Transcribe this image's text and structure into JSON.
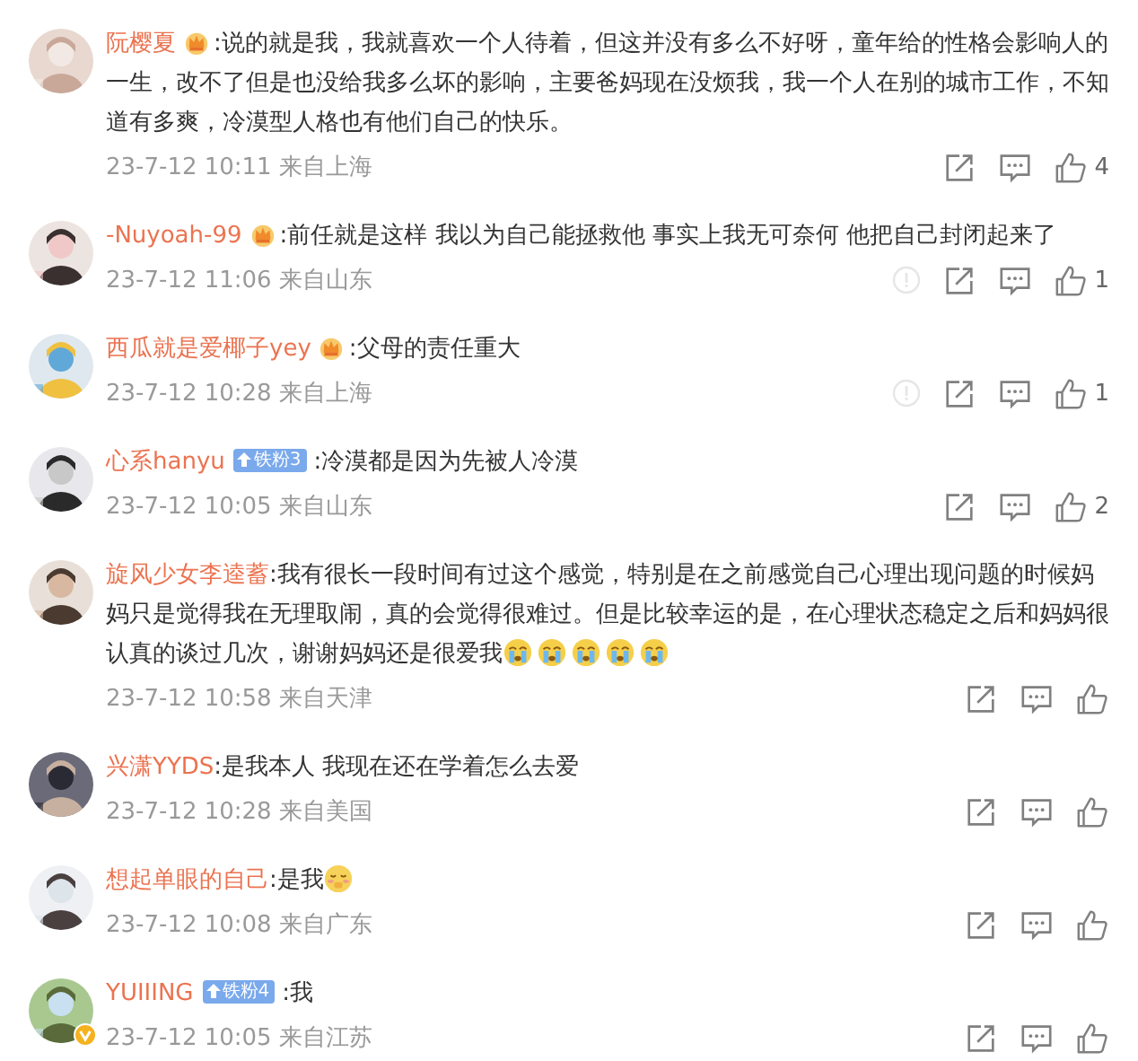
{
  "comments": [
    {
      "name": "阮樱夏",
      "badge": {
        "kind": "crown"
      },
      "text": ":说的就是我，我就喜欢一个人待着，但这并没有多么不好呀，童年给的性格会影响人的一生，改不了但是也没给我多么坏的影响，主要爸妈现在没烦我，我一个人在别的城市工作，不知道有多爽，冷漠型人格也有他们自己的快乐。",
      "time": "23-7-12 10:11 来自上海",
      "likes": "4"
    },
    {
      "name": "-Nuyoah-99",
      "badge": {
        "kind": "crown"
      },
      "text": ":前任就是这样 我以为自己能拯救他 事实上我无可奈何 他把自己封闭起来了",
      "time": "23-7-12 11:06 来自山东",
      "report": true,
      "likes": "1"
    },
    {
      "name": "西瓜就是爱椰子yey",
      "badge": {
        "kind": "crown"
      },
      "text": ":父母的责任重大",
      "time": "23-7-12 10:28 来自上海",
      "report": true,
      "likes": "1"
    },
    {
      "name": "心系hanyu",
      "badge": {
        "kind": "fan",
        "label": "铁粉3"
      },
      "text": ":冷漠都是因为先被人冷漠",
      "time": "23-7-12 10:05 来自山东",
      "likes": "2"
    },
    {
      "name": "旋风少女李逵蓄",
      "text": ":我有很长一段时间有过这个感觉，特别是在之前感觉自己心理出现问题的时候妈妈只是觉得我在无理取闹，真的会觉得很难过。但是比较幸运的是，在心理状态稳定之后和妈妈很认真的谈过几次，谢谢妈妈还是很爱我",
      "emojis": [
        {
          "kind": "crying"
        },
        {
          "kind": "crying"
        },
        {
          "kind": "crying"
        },
        {
          "kind": "crying"
        },
        {
          "kind": "crying"
        }
      ],
      "time": "23-7-12 10:58 来自天津"
    },
    {
      "name": "兴潇YYDS",
      "text": ":是我本人 我现在还在学着怎么去爱",
      "time": "23-7-12 10:28 来自美国"
    },
    {
      "name": "想起单眼的自己",
      "text": ":是我",
      "emojis": [
        {
          "kind": "shy"
        }
      ],
      "time": "23-7-12 10:08 来自广东"
    },
    {
      "name": "YUIIING",
      "badge": {
        "kind": "fan",
        "label": "铁粉4"
      },
      "text": ":我",
      "time": "23-7-12 10:05 来自江苏",
      "verified": true
    }
  ]
}
